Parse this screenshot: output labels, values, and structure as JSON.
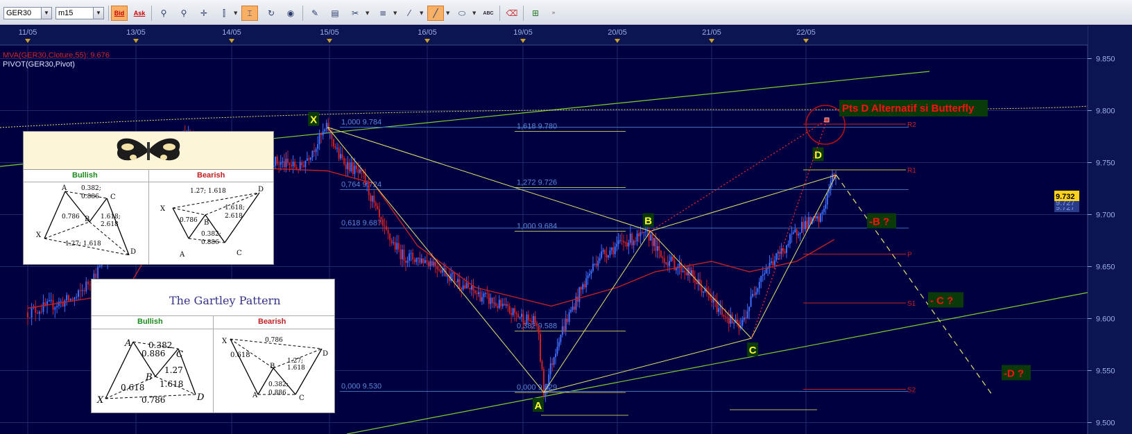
{
  "toolbar": {
    "symbol": "GER30",
    "timeframe": "m15",
    "bid_label": "Bid",
    "ask_label": "Ask",
    "abc_label": "ABC"
  },
  "indicators": {
    "mva": "MVA(GER30,Cloture,55): 9.676",
    "pivot": "PIVOT(GER30,Pivot)"
  },
  "colors": {
    "background": "#000040",
    "grid": "#1e2a6a",
    "price_axis": "#0c154f",
    "trend": "#7fcf2a",
    "harmonic": "#e5e56a",
    "fib": "#3d6fbf",
    "mva": "#c22222",
    "annotation_red": "#ff1010",
    "marker_bg": "#0a3a0a"
  },
  "chart_data": {
    "type": "candlestick",
    "symbol": "GER30",
    "timeframe": "m15",
    "x_ticks": [
      "11/05",
      "13/05",
      "14/05",
      "15/05",
      "16/05",
      "19/05",
      "20/05",
      "21/05",
      "22/05"
    ],
    "y_ticks": [
      "9.850",
      "9.800",
      "9.750",
      "9.700",
      "9.650",
      "9.600",
      "9.550",
      "9.500"
    ],
    "ylim": [
      9.497,
      9.857
    ],
    "current_price": "9.732",
    "price_tags": [
      "9.732",
      "9.727",
      "9.727"
    ],
    "mva_value": 9.676,
    "price_path": [
      {
        "t": 0.0,
        "p": 9.606
      },
      {
        "t": 0.45,
        "p": 9.62
      },
      {
        "t": 0.75,
        "p": 9.66
      },
      {
        "t": 0.92,
        "p": 9.7
      },
      {
        "t": 1.05,
        "p": 9.745
      },
      {
        "t": 1.25,
        "p": 9.77
      },
      {
        "t": 1.55,
        "p": 9.775
      },
      {
        "t": 1.85,
        "p": 9.762
      },
      {
        "t": 2.25,
        "p": 9.755
      },
      {
        "t": 2.7,
        "p": 9.745
      },
      {
        "t": 2.98,
        "p": 9.784
      },
      {
        "t": 3.1,
        "p": 9.755
      },
      {
        "t": 3.35,
        "p": 9.735
      },
      {
        "t": 3.55,
        "p": 9.685
      },
      {
        "t": 3.75,
        "p": 9.66
      },
      {
        "t": 4.05,
        "p": 9.655
      },
      {
        "t": 4.4,
        "p": 9.63
      },
      {
        "t": 4.9,
        "p": 9.605
      },
      {
        "t": 5.15,
        "p": 9.595
      },
      {
        "t": 5.22,
        "p": 9.529
      },
      {
        "t": 5.38,
        "p": 9.582
      },
      {
        "t": 5.6,
        "p": 9.625
      },
      {
        "t": 5.8,
        "p": 9.66
      },
      {
        "t": 6.1,
        "p": 9.675
      },
      {
        "t": 6.35,
        "p": 9.68
      },
      {
        "t": 6.45,
        "p": 9.66
      },
      {
        "t": 6.75,
        "p": 9.645
      },
      {
        "t": 7.05,
        "p": 9.612
      },
      {
        "t": 7.3,
        "p": 9.59
      },
      {
        "t": 7.52,
        "p": 9.642
      },
      {
        "t": 7.75,
        "p": 9.665
      },
      {
        "t": 7.95,
        "p": 9.69
      },
      {
        "t": 8.15,
        "p": 9.695
      },
      {
        "t": 8.28,
        "p": 9.735
      },
      {
        "t": 8.32,
        "p": 9.738
      }
    ],
    "mva_path": [
      {
        "t": 0.0,
        "p": 9.61
      },
      {
        "t": 0.9,
        "p": 9.625
      },
      {
        "t": 1.5,
        "p": 9.72
      },
      {
        "t": 2.2,
        "p": 9.745
      },
      {
        "t": 2.98,
        "p": 9.742
      },
      {
        "t": 3.45,
        "p": 9.73
      },
      {
        "t": 3.9,
        "p": 9.67
      },
      {
        "t": 4.5,
        "p": 9.63
      },
      {
        "t": 5.3,
        "p": 9.612
      },
      {
        "t": 6.0,
        "p": 9.63
      },
      {
        "t": 6.4,
        "p": 9.645
      },
      {
        "t": 7.0,
        "p": 9.655
      },
      {
        "t": 7.4,
        "p": 9.645
      },
      {
        "t": 7.9,
        "p": 9.655
      },
      {
        "t": 8.3,
        "p": 9.676
      }
    ],
    "harmonic_points": [
      {
        "label": "X",
        "t": 2.98,
        "p": 9.784
      },
      {
        "label": "A",
        "t": 5.22,
        "p": 9.529
      },
      {
        "label": "B",
        "t": 6.35,
        "p": 9.684
      },
      {
        "label": "C",
        "t": 7.42,
        "p": 9.581
      },
      {
        "label": "D",
        "t": 8.32,
        "p": 9.738
      }
    ],
    "fib_left": [
      {
        "label": "1,000 9.784",
        "p": 9.784
      },
      {
        "label": "0,764 9.724",
        "p": 9.724
      },
      {
        "label": "0,618 9.687",
        "p": 9.687
      },
      {
        "label": "0,000 9.530",
        "p": 9.53
      }
    ],
    "fib_mid": [
      {
        "label": "1,618 9.780",
        "p": 9.78
      },
      {
        "label": "1,272 9.726",
        "p": 9.726
      },
      {
        "label": "1,000 9.684",
        "p": 9.684
      },
      {
        "label": "0,382 9.588",
        "p": 9.588
      },
      {
        "label": "0,000 9.529",
        "p": 9.529
      }
    ],
    "pivots": [
      {
        "label": "R2",
        "p": 9.787
      },
      {
        "label": "R1",
        "p": 9.743
      },
      {
        "label": "P",
        "p": 9.662
      },
      {
        "label": "S1",
        "p": 9.615
      },
      {
        "label": "S2",
        "p": 9.532
      }
    ],
    "projections": [
      {
        "label": "-B ?",
        "p": 9.694
      },
      {
        "label": "- C ?",
        "p": 9.618
      },
      {
        "label": "-D ?",
        "p": 9.548
      }
    ],
    "callout": "Pts D Alternatif si Butterfly"
  },
  "butterfly_panel": {
    "bullish": "Bullish",
    "bearish": "Bearish",
    "bull_labels": [
      "A",
      "0.382;",
      "0.886",
      "C",
      "0.786",
      "B",
      "1.618;",
      "2.618",
      "X",
      "1.27; 1.618",
      "D"
    ],
    "bear_labels": [
      "D",
      "1.27; 1.618",
      "X",
      "0.786",
      "B",
      "1.618;",
      "2.618",
      "0.382;",
      "0.886",
      "C",
      "A"
    ]
  },
  "gartley_panel": {
    "title": "The Gartley Pattern",
    "bullish": "Bullish",
    "bearish": "Bearish",
    "bull_labels": [
      "A",
      "0.382",
      "C",
      "0.886",
      "1.27",
      "0.618",
      "B",
      "1.618",
      "X",
      "0.786",
      "D"
    ],
    "bear_labels": [
      "X",
      "0.786",
      "D",
      "0.618",
      "B",
      "1.27;",
      "1.618",
      "0.382;",
      "0.886",
      "A",
      "C"
    ]
  }
}
